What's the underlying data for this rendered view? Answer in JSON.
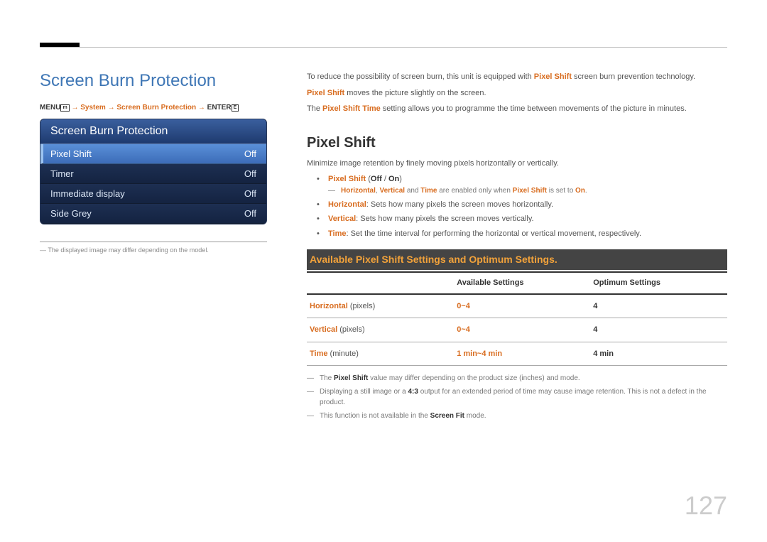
{
  "title": "Screen Burn Protection",
  "breadcrumb": {
    "menu": "MENU",
    "path1": "System",
    "path2": "Screen Burn Protection",
    "enter": "ENTER"
  },
  "osd": {
    "header": "Screen Burn Protection",
    "rows": [
      {
        "label": "Pixel Shift",
        "value": "Off",
        "selected": true
      },
      {
        "label": "Timer",
        "value": "Off",
        "selected": false
      },
      {
        "label": "Immediate display",
        "value": "Off",
        "selected": false
      },
      {
        "label": "Side Grey",
        "value": "Off",
        "selected": false
      }
    ]
  },
  "left_footnote": "The displayed image may differ depending on the model.",
  "intro": {
    "line1_a": "To reduce the possibility of screen burn, this unit is equipped with ",
    "line1_b": "Pixel Shift",
    "line1_c": " screen burn prevention technology.",
    "line2_a": "Pixel Shift",
    "line2_b": " moves the picture slightly on the screen.",
    "line3_a": "The ",
    "line3_b": "Pixel Shift Time",
    "line3_c": " setting allows you to programme the time between movements of the picture in minutes."
  },
  "pixelshift": {
    "heading": "Pixel Shift",
    "desc": "Minimize image retention by finely moving pixels horizontally or vertically.",
    "item1_a": "Pixel Shift",
    "item1_b": " (",
    "item1_c": "Off",
    "item1_d": " / ",
    "item1_e": "On",
    "item1_f": ")",
    "note_a": "Horizontal",
    "note_b": ", ",
    "note_c": "Vertical",
    "note_d": " and ",
    "note_e": "Time",
    "note_f": " are enabled only when ",
    "note_g": "Pixel Shift",
    "note_h": " is set to ",
    "note_i": "On",
    "note_j": ".",
    "item2_a": "Horizontal",
    "item2_b": ": Sets how many pixels the screen moves horizontally.",
    "item3_a": "Vertical",
    "item3_b": ": Sets how many pixels the screen moves vertically.",
    "item4_a": "Time",
    "item4_b": ": Set the time interval for performing the horizontal or vertical movement, respectively."
  },
  "table_heading": "Available Pixel Shift Settings and Optimum Settings.",
  "table": {
    "col_blank": "",
    "col_avail": "Available Settings",
    "col_opt": "Optimum Settings",
    "rows": [
      {
        "name": "Horizontal",
        "unit": " (pixels)",
        "avail": "0~4",
        "opt": "4"
      },
      {
        "name": "Vertical",
        "unit": " (pixels)",
        "avail": "0~4",
        "opt": "4"
      },
      {
        "name": "Time",
        "unit": " (minute)",
        "avail": "1 min~4 min",
        "opt": "4 min"
      }
    ]
  },
  "notes": {
    "n1_a": "The ",
    "n1_b": "Pixel Shift",
    "n1_c": " value may differ depending on the product size (inches) and mode.",
    "n2_a": "Displaying a still image or a ",
    "n2_b": "4:3",
    "n2_c": " output for an extended period of time may cause image retention. This is not a defect in the product.",
    "n3_a": "This function is not available in the ",
    "n3_b": "Screen Fit",
    "n3_c": " mode."
  },
  "page_number": "127"
}
